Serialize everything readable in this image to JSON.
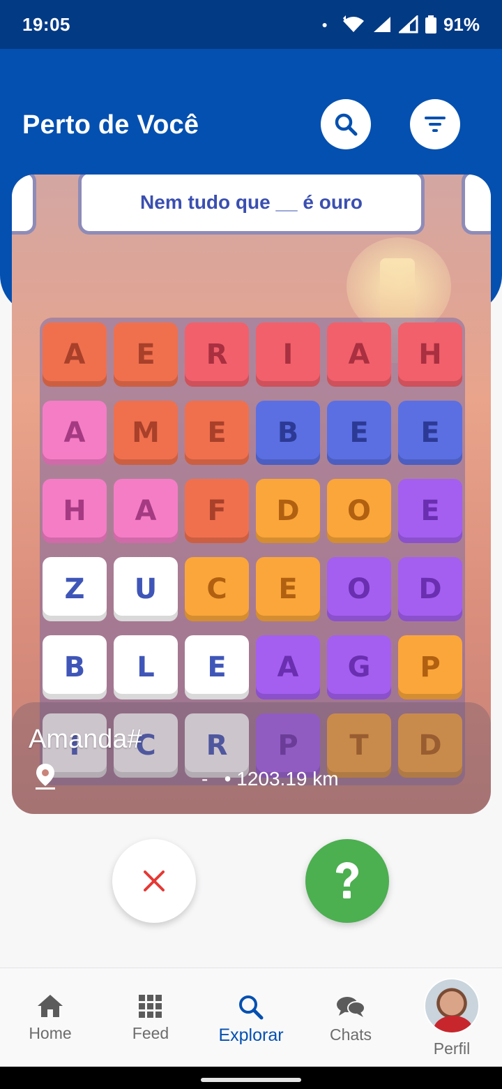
{
  "status": {
    "time": "19:05",
    "battery": "91%"
  },
  "header": {
    "title": "Perto de Você"
  },
  "card": {
    "puzzle_clue": "Nem tudo que __ é ouro",
    "letters": {
      "r0": [
        "A",
        "E",
        "R",
        "I",
        "A",
        "H"
      ],
      "r1": [
        "A",
        "M",
        "E",
        "B",
        "E",
        "E"
      ],
      "r2": [
        "H",
        "A",
        "F",
        "D",
        "O",
        "E"
      ],
      "r3": [
        "Z",
        "U",
        "C",
        "E",
        "O",
        "D"
      ],
      "r4": [
        "B",
        "L",
        "E",
        "A",
        "G",
        "P"
      ],
      "r5": [
        "I",
        "C",
        "R",
        "P",
        "T",
        "D"
      ]
    },
    "colors": {
      "orange_red": "#f0704e",
      "red": "#f2606b",
      "pink": "#f57dc6",
      "blue": "#5b6fe3",
      "orange": "#fba63a",
      "purple": "#a45ff0",
      "white": "#ffffff"
    },
    "user_name": "Amanda#",
    "location_separator": "-",
    "distance": "• 1203.19 km"
  },
  "actions": {
    "dislike_icon": "close-icon",
    "like_icon": "question-icon"
  },
  "nav": {
    "items": [
      {
        "label": "Home",
        "icon": "home-icon"
      },
      {
        "label": "Feed",
        "icon": "grid-icon"
      },
      {
        "label": "Explorar",
        "icon": "search-icon"
      },
      {
        "label": "Chats",
        "icon": "chat-icon"
      },
      {
        "label": "Perfil",
        "icon": "avatar"
      }
    ]
  }
}
